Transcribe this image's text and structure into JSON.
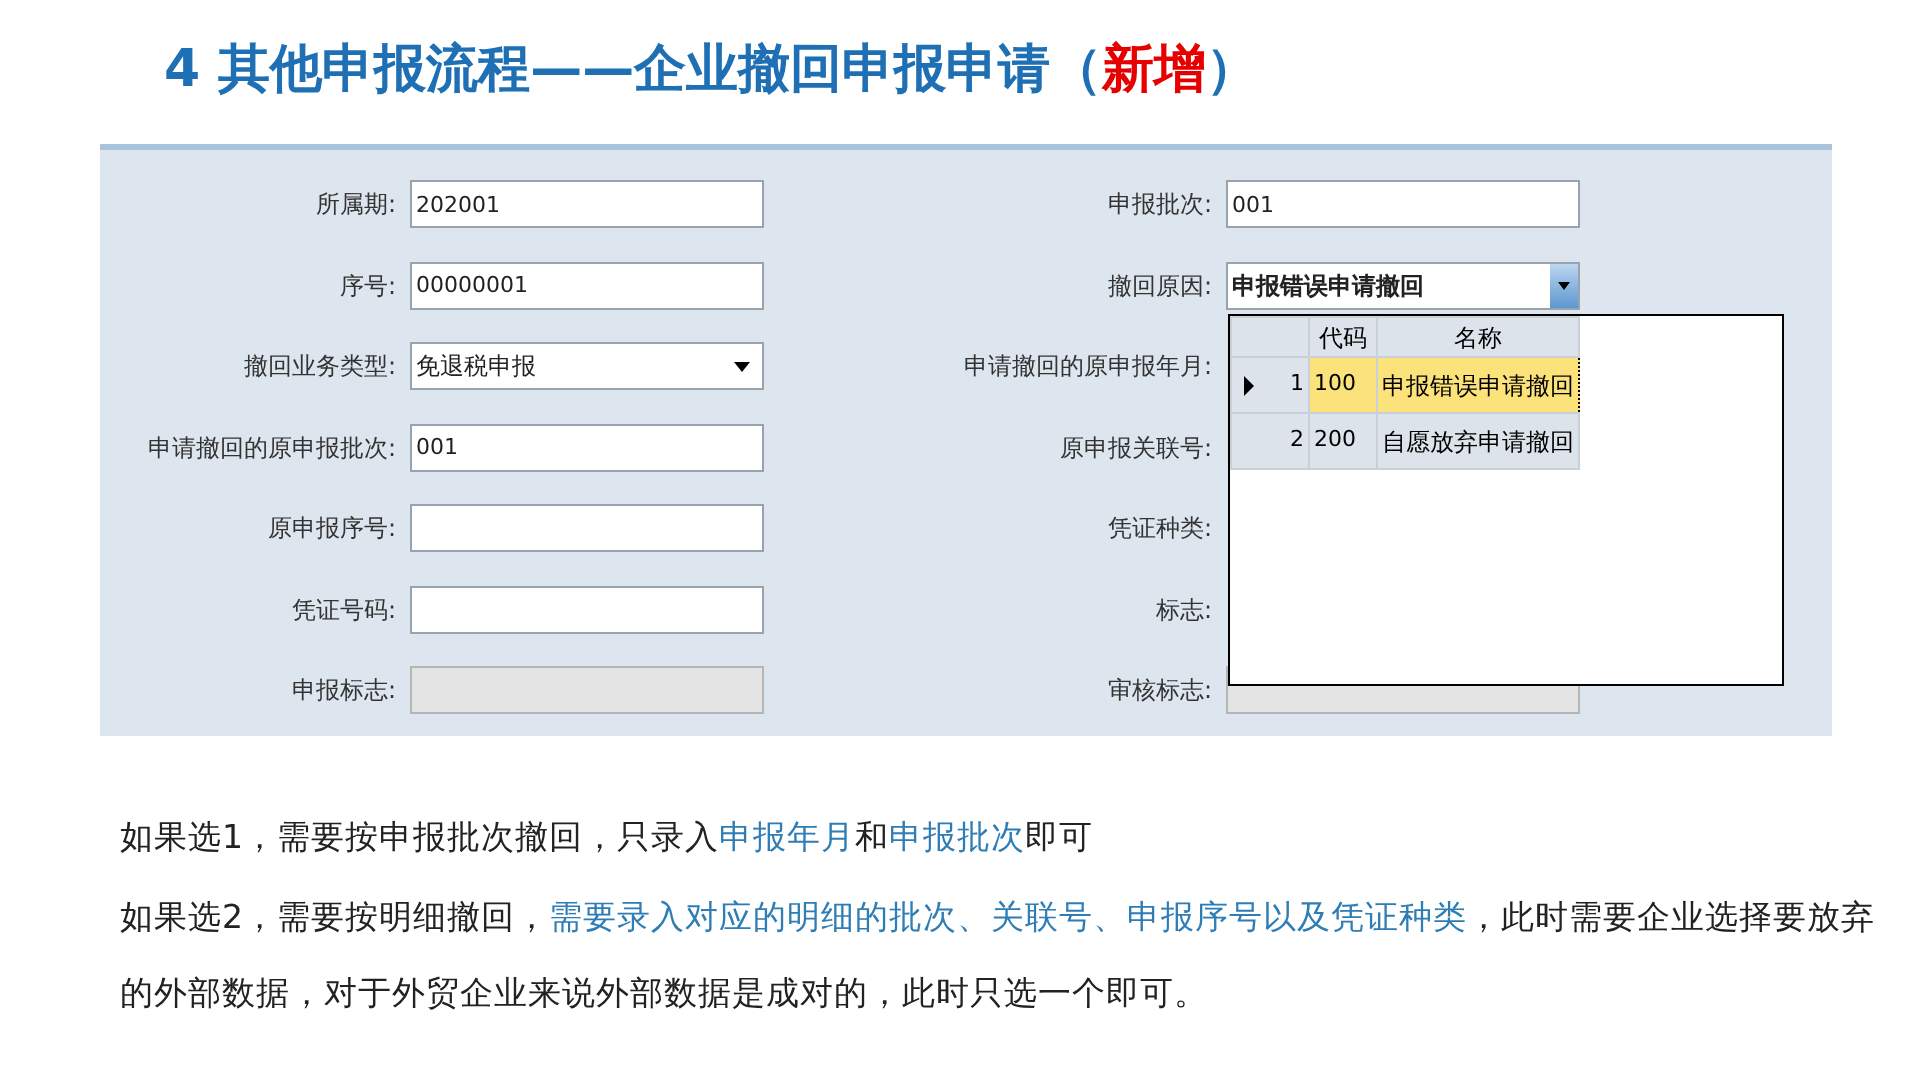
{
  "title": [
    {
      "text": "4 其他申报流程——企业撤回申报申请（",
      "highlight": false
    },
    {
      "text": "新增",
      "highlight": true
    },
    {
      "text": "）",
      "highlight": false
    }
  ],
  "form": {
    "left": [
      {
        "label": "所属期:",
        "kind": "text",
        "value": "202001"
      },
      {
        "label": "序号:",
        "kind": "text",
        "value": "00000001"
      },
      {
        "label": "撤回业务类型:",
        "kind": "select",
        "value": "免退税申报"
      },
      {
        "label": "申请撤回的原申报批次:",
        "kind": "text",
        "value": "001"
      },
      {
        "label": "原申报序号:",
        "kind": "text"
      },
      {
        "label": "凭证号码:",
        "kind": "text"
      },
      {
        "label": "申报标志:",
        "kind": "disabled"
      }
    ],
    "right": [
      {
        "label": "申报批次:",
        "kind": "text",
        "value": "001"
      },
      {
        "label": "撤回原因:",
        "kind": "combo",
        "value": "申报错误申请撤回"
      },
      {
        "label": "申请撤回的原申报年月:",
        "kind": "hidden"
      },
      {
        "label": "原申报关联号:",
        "kind": "hidden"
      },
      {
        "label": "凭证种类:",
        "kind": "hidden"
      },
      {
        "label": "标志:",
        "kind": "hidden"
      },
      {
        "label": "审核标志:",
        "kind": "disabled"
      }
    ],
    "dropdown": {
      "columns": [
        "代码",
        "名称"
      ],
      "rows": [
        {
          "index": "1",
          "code": "100",
          "name": "申报错误申请撤回",
          "selected": true
        },
        {
          "index": "2",
          "code": "200",
          "name": "自愿放弃申请撤回",
          "selected": false
        }
      ]
    }
  },
  "notes": [
    [
      {
        "text": "如果选1，需要按申报批次撤回，只录入",
        "highlight": false
      },
      {
        "text": "申报年月",
        "highlight": true
      },
      {
        "text": "和",
        "highlight": false
      },
      {
        "text": "申报批次",
        "highlight": true
      },
      {
        "text": "即可",
        "highlight": false
      }
    ],
    [
      {
        "text": "如果选2，需要按明细撤回，",
        "highlight": false
      },
      {
        "text": "需要录入对应的明细的批次、关联号、申报序号以及凭证种类",
        "highlight": true
      },
      {
        "text": "，此时需要企业选择要放弃的外部数据，对于外贸企业来说外部数据是成对的，此时只选一个即可。",
        "highlight": false
      }
    ]
  ]
}
